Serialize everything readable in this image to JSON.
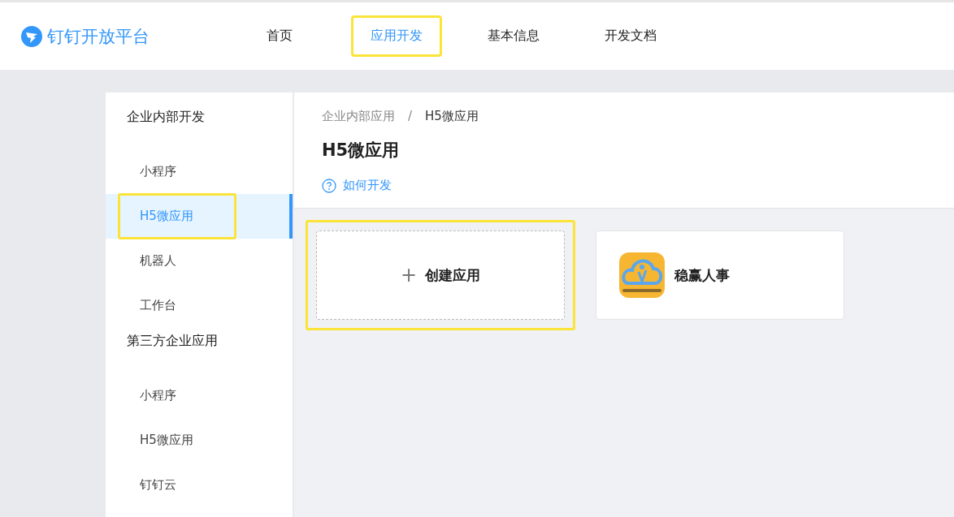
{
  "brand": {
    "name": "钉钉开放平台"
  },
  "nav": [
    {
      "label": "首页",
      "selected": false,
      "highlighted": false
    },
    {
      "label": "应用开发",
      "selected": true,
      "highlighted": true
    },
    {
      "label": "基本信息",
      "selected": false,
      "highlighted": false
    },
    {
      "label": "开发文档",
      "selected": false,
      "highlighted": false
    }
  ],
  "sidebar": {
    "groups": [
      {
        "label": "企业内部开发",
        "children": [
          {
            "label": "小程序",
            "selected": false,
            "highlighted": false
          },
          {
            "label": "H5微应用",
            "selected": true,
            "highlighted": true
          },
          {
            "label": "机器人",
            "selected": false,
            "highlighted": false
          },
          {
            "label": "工作台",
            "selected": false,
            "highlighted": false
          }
        ]
      },
      {
        "label": "第三方企业应用",
        "children": [
          {
            "label": "小程序",
            "selected": false,
            "highlighted": false
          },
          {
            "label": "H5微应用",
            "selected": false,
            "highlighted": false
          },
          {
            "label": "钉钉云",
            "selected": false,
            "highlighted": false
          }
        ]
      }
    ]
  },
  "breadcrumb": [
    "企业内部应用",
    "/",
    "H5微应用"
  ],
  "page_title": "H5微应用",
  "help_link": "如何开发",
  "cards": [
    {
      "kind": "create",
      "icon": "+",
      "label": "创建应用",
      "highlighted": true
    },
    {
      "kind": "app",
      "label": "稳赢人事",
      "highlighted": false
    }
  ]
}
